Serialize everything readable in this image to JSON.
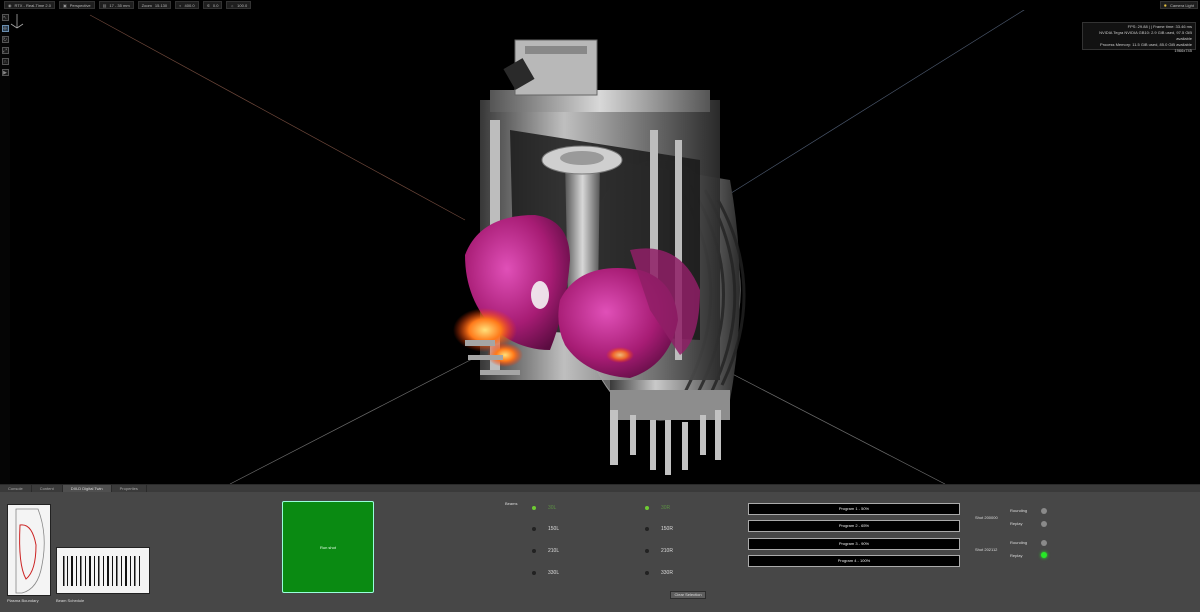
{
  "toolbar": {
    "mode": "RTX - Real-Time 2.0",
    "camera": "Perspective",
    "lens": "17 - 35 mm",
    "zoom_label": "Zoom",
    "zoom_value": "15.130",
    "value_a": "400.0",
    "value_b": "0.0",
    "value_c": "100.0",
    "camera_light": "Camera Light"
  },
  "stats": {
    "line1": "FPS: 29.88 | | Frame time: 33.46 ms",
    "line2": "NVIDIA Tegra NVIDIA GB10: 2.9 GiB used, 97.5 GiB available",
    "line3": "Process Memory: 11.5 GiB used, 85.0 GiB available",
    "line4": "1966x745"
  },
  "tabs": [
    "Console",
    "Content",
    "DIII-D Digital Twin",
    "Properties"
  ],
  "thumbs": {
    "plasma_label": "Plasma Boundary",
    "beam_label": "Beam Schedule"
  },
  "run": {
    "label": "Run shot"
  },
  "beams": {
    "title": "Beams",
    "left": [
      {
        "label": "30L",
        "on": true
      },
      {
        "label": "150L",
        "on": false
      },
      {
        "label": "210L",
        "on": false
      },
      {
        "label": "330L",
        "on": false
      }
    ],
    "right": [
      {
        "label": "30R",
        "on": true
      },
      {
        "label": "150R",
        "on": false
      },
      {
        "label": "210R",
        "on": false
      },
      {
        "label": "330R",
        "on": false
      }
    ],
    "clear_label": "Clear Selection"
  },
  "programs": [
    "Program 1 - 50%",
    "Program 2 - 65%",
    "Program 3 - 90%",
    "Program 4 - 100%"
  ],
  "shots": [
    {
      "label": "Shot 200000",
      "rows": [
        {
          "label": "Rounding",
          "state": "off"
        },
        {
          "label": "Replay",
          "state": "off"
        }
      ]
    },
    {
      "label": "Shot 202112",
      "rows": [
        {
          "label": "Rounding",
          "state": "off"
        },
        {
          "label": "Replay",
          "state": "on"
        }
      ]
    }
  ],
  "colors": {
    "plasma": "#b0207a",
    "run_green": "#0a8a12",
    "led_on": "#27e827"
  }
}
